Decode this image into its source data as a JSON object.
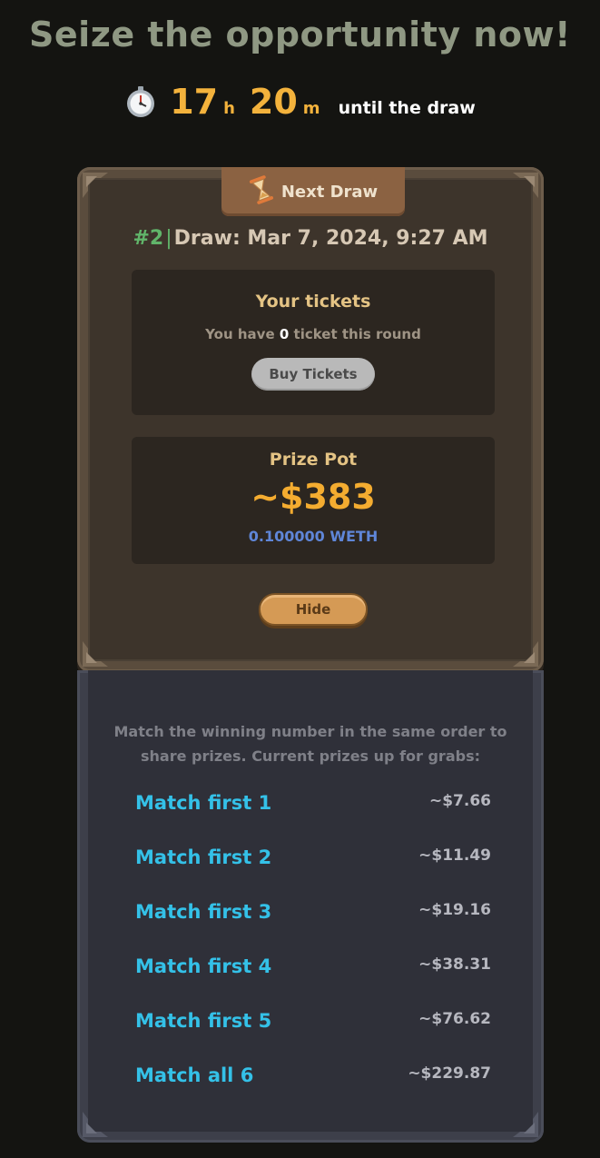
{
  "headline": "Seize the opportunity now!",
  "countdown": {
    "icon": "stopwatch-icon",
    "hours": "17",
    "hours_unit": "h",
    "minutes": "20",
    "minutes_unit": "m",
    "suffix": "until the draw"
  },
  "next_draw": {
    "tab_label": "Next Draw",
    "tab_icon": "hourglass-icon",
    "round": "#2",
    "draw_text": "Draw: Mar 7, 2024, 9:27 AM"
  },
  "tickets": {
    "title": "Your tickets",
    "prefix": "You have",
    "count": "0",
    "suffix": "ticket this round",
    "buy_label": "Buy Tickets"
  },
  "prize_pot": {
    "title": "Prize Pot",
    "value": "~$383",
    "weth": "0.100000 WETH"
  },
  "hide_label": "Hide",
  "prizes": {
    "explanation_line1": "Match the winning number in the same order to",
    "explanation_line2": "share prizes. Current prizes up for grabs:",
    "rows": [
      {
        "label": "Match first 1",
        "value": "~$7.66"
      },
      {
        "label": "Match first 2",
        "value": "~$11.49"
      },
      {
        "label": "Match first 3",
        "value": "~$19.16"
      },
      {
        "label": "Match first 4",
        "value": "~$38.31"
      },
      {
        "label": "Match first 5",
        "value": "~$76.62"
      },
      {
        "label": "Match all 6",
        "value": "~$229.87"
      }
    ]
  },
  "colors": {
    "accent_orange": "#f3b23c",
    "prize_cyan": "#34c1e8",
    "round_green": "#61b56a",
    "weth_blue": "#5f86d8"
  }
}
